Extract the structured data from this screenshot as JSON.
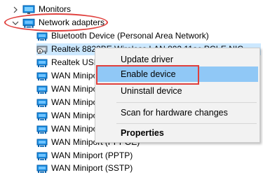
{
  "tree": {
    "items": [
      {
        "label": "Monitors",
        "state": "collapsed",
        "icon": "monitor-icon"
      },
      {
        "label": "Network adapters",
        "state": "expanded",
        "icon": "network-adapter-icon"
      },
      {
        "label": "Bluetooth Device (Personal Area Network)",
        "icon": "network-adapter-icon"
      },
      {
        "label": "Realtek 8822BE Wireless LAN 802.11ac PCI-E NIC",
        "icon": "disabled-network-adapter-icon",
        "selected": true
      },
      {
        "label": "Realtek USB GbE Family Controller",
        "icon": "network-adapter-icon"
      },
      {
        "label": "WAN Miniport (IKEv2)",
        "icon": "network-adapter-icon"
      },
      {
        "label": "WAN Miniport (IP)",
        "icon": "network-adapter-icon"
      },
      {
        "label": "WAN Miniport (IPv6)",
        "icon": "network-adapter-icon"
      },
      {
        "label": "WAN Miniport (L2TP)",
        "icon": "network-adapter-icon"
      },
      {
        "label": "WAN Miniport (Network Monitor)",
        "icon": "network-adapter-icon"
      },
      {
        "label": "WAN Miniport (PPPOE)",
        "icon": "network-adapter-icon"
      },
      {
        "label": "WAN Miniport (PPTP)",
        "icon": "network-adapter-icon"
      },
      {
        "label": "WAN Miniport (SSTP)",
        "icon": "network-adapter-icon"
      }
    ]
  },
  "context_menu": {
    "items": [
      {
        "label": "Update driver"
      },
      {
        "label": "Enable device",
        "highlighted": true
      },
      {
        "label": "Uninstall device"
      },
      {
        "label": "Scan for hardware changes"
      },
      {
        "label": "Properties",
        "bold": true
      }
    ]
  },
  "colors": {
    "annotation_red": "#e0403d",
    "selection_blue": "#cce8ff",
    "menu_hover_blue": "#90c8f6",
    "icon_blue": "#1a8fe3"
  }
}
